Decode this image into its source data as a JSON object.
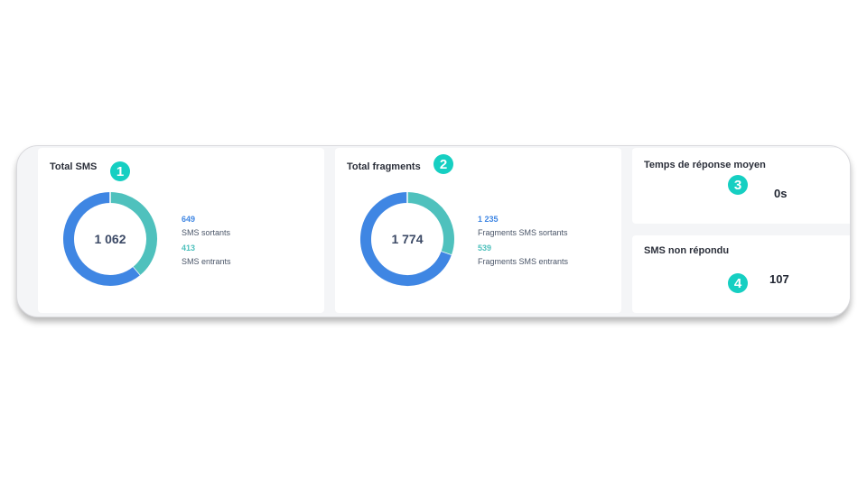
{
  "cards": {
    "total_sms": {
      "title": "Total SMS",
      "total": "1 062",
      "outgoing": {
        "value": "649",
        "label": "SMS sortants"
      },
      "incoming": {
        "value": "413",
        "label": "SMS entrants"
      }
    },
    "total_fragments": {
      "title": "Total fragments",
      "total": "1 774",
      "outgoing": {
        "value": "1 235",
        "label": "Fragments SMS sortants"
      },
      "incoming": {
        "value": "539",
        "label": "Fragments SMS entrants"
      }
    },
    "response_time": {
      "title": "Temps de réponse moyen",
      "value": "0s"
    },
    "unanswered": {
      "title": "SMS non répondu",
      "value": "107"
    }
  },
  "badges": [
    "1",
    "2",
    "3",
    "4"
  ],
  "colors": {
    "outgoing": "#3f86e3",
    "incoming": "#4fc1bd",
    "badge": "#16cfc2"
  },
  "chart_data": [
    {
      "type": "pie",
      "categories": [
        "SMS sortants",
        "SMS entrants"
      ],
      "values": [
        649,
        413
      ],
      "title": "Total SMS",
      "center_label": "1 062"
    },
    {
      "type": "pie",
      "categories": [
        "Fragments SMS sortants",
        "Fragments SMS entrants"
      ],
      "values": [
        1235,
        539
      ],
      "title": "Total fragments",
      "center_label": "1 774"
    }
  ]
}
